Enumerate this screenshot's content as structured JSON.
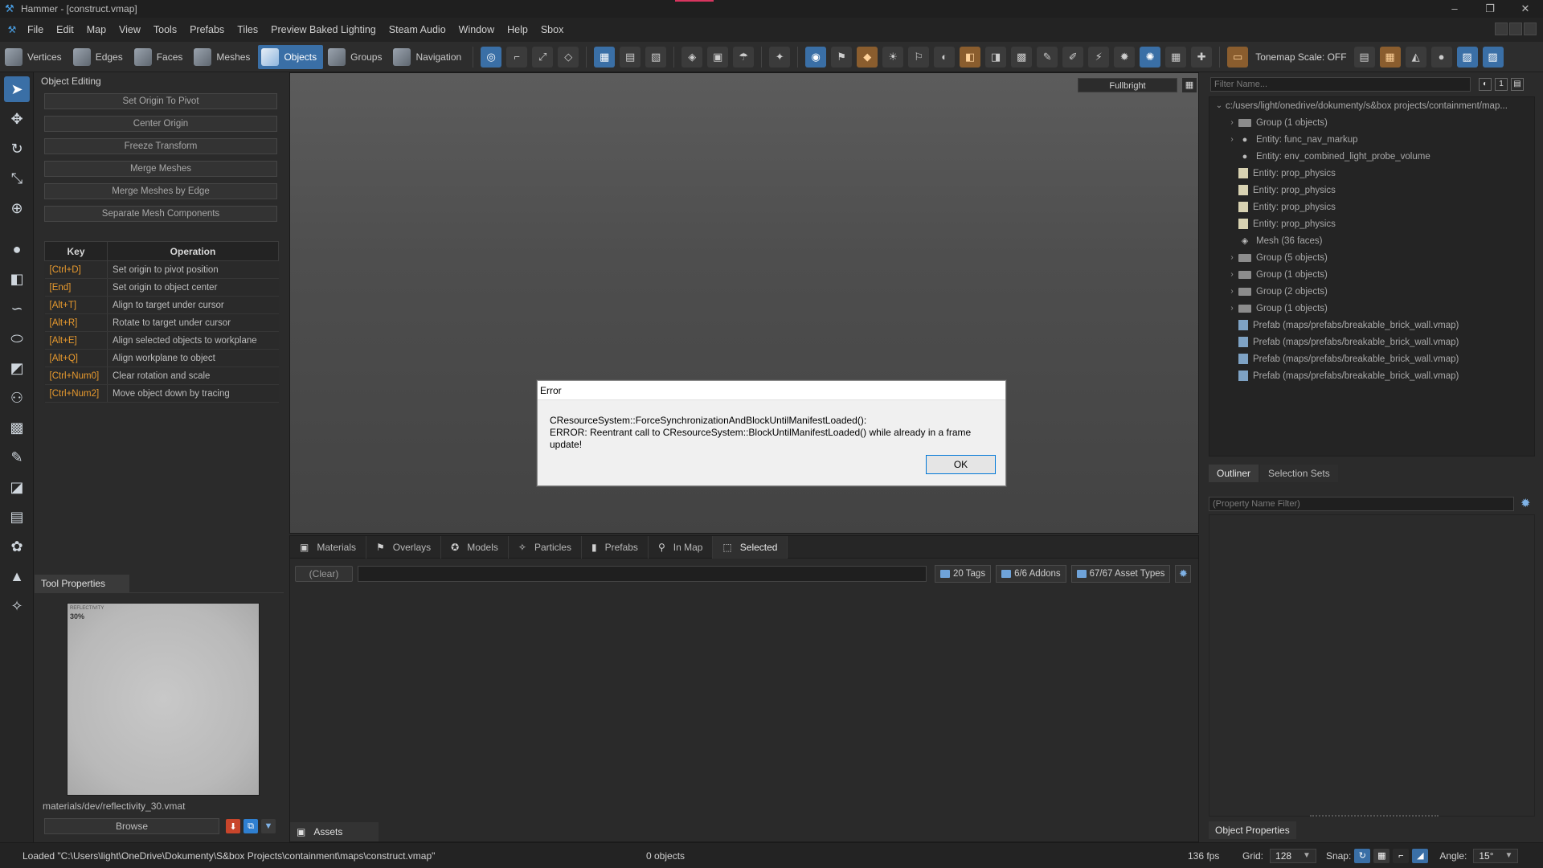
{
  "window": {
    "title": "Hammer - [construct.vmap]",
    "controls": [
      "–",
      "❐",
      "✕"
    ]
  },
  "menu": {
    "items": [
      "File",
      "Edit",
      "Map",
      "View",
      "Tools",
      "Prefabs",
      "Tiles",
      "Preview Baked Lighting",
      "Steam Audio",
      "Window",
      "Help",
      "Sbox"
    ]
  },
  "toolbar": {
    "modes": [
      {
        "label": "Vertices",
        "active": false
      },
      {
        "label": "Edges",
        "active": false
      },
      {
        "label": "Faces",
        "active": false
      },
      {
        "label": "Meshes",
        "active": false
      },
      {
        "label": "Objects",
        "active": true
      },
      {
        "label": "Groups",
        "active": false
      },
      {
        "label": "Navigation",
        "active": false
      }
    ],
    "tonemap_label": "Tonemap Scale: OFF"
  },
  "object_editing": {
    "title": "Object Editing",
    "buttons": [
      "Set Origin To Pivot",
      "Center Origin",
      "Freeze Transform",
      "Merge Meshes",
      "Merge Meshes by Edge",
      "Separate Mesh Components"
    ],
    "table": {
      "headers": [
        "Key",
        "Operation"
      ],
      "rows": [
        {
          "key": "[Ctrl+D]",
          "op": "Set origin to pivot position"
        },
        {
          "key": "[End]",
          "op": "Set origin to object center"
        },
        {
          "key": "[Alt+T]",
          "op": "Align to target under cursor"
        },
        {
          "key": "[Alt+R]",
          "op": "Rotate to target under cursor"
        },
        {
          "key": "[Alt+E]",
          "op": "Align selected objects to workplane"
        },
        {
          "key": "[Alt+Q]",
          "op": "Align workplane to object"
        },
        {
          "key": "[Ctrl+Num0]",
          "op": "Clear rotation and scale"
        },
        {
          "key": "[Ctrl+Num2]",
          "op": "Move object down by tracing"
        }
      ]
    }
  },
  "tool_properties": {
    "tab": "Tool Properties",
    "material_label_small": "REFLECTIVITY",
    "material_label_big": "30%",
    "material_path": "materials/dev/reflectivity_30.vmat",
    "browse_label": "Browse"
  },
  "viewport": {
    "render_mode": "Fullbright"
  },
  "asset_browser": {
    "tabs": [
      {
        "label": "Materials",
        "icon": "image-icon"
      },
      {
        "label": "Overlays",
        "icon": "overlay-icon"
      },
      {
        "label": "Models",
        "icon": "model-icon"
      },
      {
        "label": "Particles",
        "icon": "particles-icon"
      },
      {
        "label": "Prefabs",
        "icon": "prefab-icon"
      },
      {
        "label": "In Map",
        "icon": "map-pin-icon"
      },
      {
        "label": "Selected",
        "icon": "selection-icon"
      }
    ],
    "clear_label": "(Clear)",
    "tags": "20 Tags",
    "addons": "6/6 Addons",
    "asset_types": "67/67 Asset Types",
    "bottom_tab": "Assets"
  },
  "outliner": {
    "filter_placeholder": "Filter Name...",
    "rows": [
      {
        "label": "c:/users/light/onedrive/dokumenty/s&box projects/containment/map...",
        "indent": 0,
        "arrow": "⌄",
        "icon": "none"
      },
      {
        "label": "Group (1 objects)",
        "indent": 1,
        "arrow": "›",
        "icon": "folder"
      },
      {
        "label": "Entity: func_nav_markup",
        "indent": 1,
        "arrow": "›",
        "icon": "bulb"
      },
      {
        "label": "Entity: env_combined_light_probe_volume",
        "indent": 1,
        "arrow": "",
        "icon": "bulb"
      },
      {
        "label": "Entity: prop_physics",
        "indent": 1,
        "arrow": "",
        "icon": "doc"
      },
      {
        "label": "Entity: prop_physics",
        "indent": 1,
        "arrow": "",
        "icon": "doc"
      },
      {
        "label": "Entity: prop_physics",
        "indent": 1,
        "arrow": "",
        "icon": "doc"
      },
      {
        "label": "Entity: prop_physics",
        "indent": 1,
        "arrow": "",
        "icon": "doc"
      },
      {
        "label": "Mesh (36 faces)",
        "indent": 1,
        "arrow": "",
        "icon": "mesh"
      },
      {
        "label": "Group (5 objects)",
        "indent": 1,
        "arrow": "›",
        "icon": "folder"
      },
      {
        "label": "Group (1 objects)",
        "indent": 1,
        "arrow": "›",
        "icon": "folder"
      },
      {
        "label": "Group (2 objects)",
        "indent": 1,
        "arrow": "›",
        "icon": "folder"
      },
      {
        "label": "Group (1 objects)",
        "indent": 1,
        "arrow": "›",
        "icon": "folder"
      },
      {
        "label": "Prefab (maps/prefabs/breakable_brick_wall.vmap)",
        "indent": 1,
        "arrow": "",
        "icon": "prefab"
      },
      {
        "label": "Prefab (maps/prefabs/breakable_brick_wall.vmap)",
        "indent": 1,
        "arrow": "",
        "icon": "prefab"
      },
      {
        "label": "Prefab (maps/prefabs/breakable_brick_wall.vmap)",
        "indent": 1,
        "arrow": "",
        "icon": "prefab"
      },
      {
        "label": "Prefab (maps/prefabs/breakable_brick_wall.vmap)",
        "indent": 1,
        "arrow": "",
        "icon": "prefab"
      }
    ],
    "tabs": [
      {
        "label": "Outliner",
        "active": true
      },
      {
        "label": "Selection Sets",
        "active": false
      }
    ],
    "property_filter_placeholder": "(Property Name Filter)",
    "bottom_tab": "Object Properties"
  },
  "status": {
    "loaded_text": "Loaded \"C:\\Users\\light\\OneDrive\\Dokumenty\\S&box Projects\\containment\\maps\\construct.vmap\"",
    "objects": "0 objects",
    "fps": "136 fps",
    "grid_label": "Grid:",
    "grid_value": "128",
    "snap_label": "Snap:",
    "angle_label": "Angle:",
    "angle_value": "15°"
  },
  "dialog": {
    "title": "Error",
    "line1": "CResourceSystem::ForceSynchronizationAndBlockUntilManifestLoaded():",
    "line2": "ERROR: Reentrant call to CResourceSystem::BlockUntilManifestLoaded() while already in a frame update!",
    "ok_label": "OK"
  },
  "colors": {
    "accent": "#3a6fa6",
    "key_orange": "#e89a2e",
    "title_accent": "#d9355f"
  }
}
